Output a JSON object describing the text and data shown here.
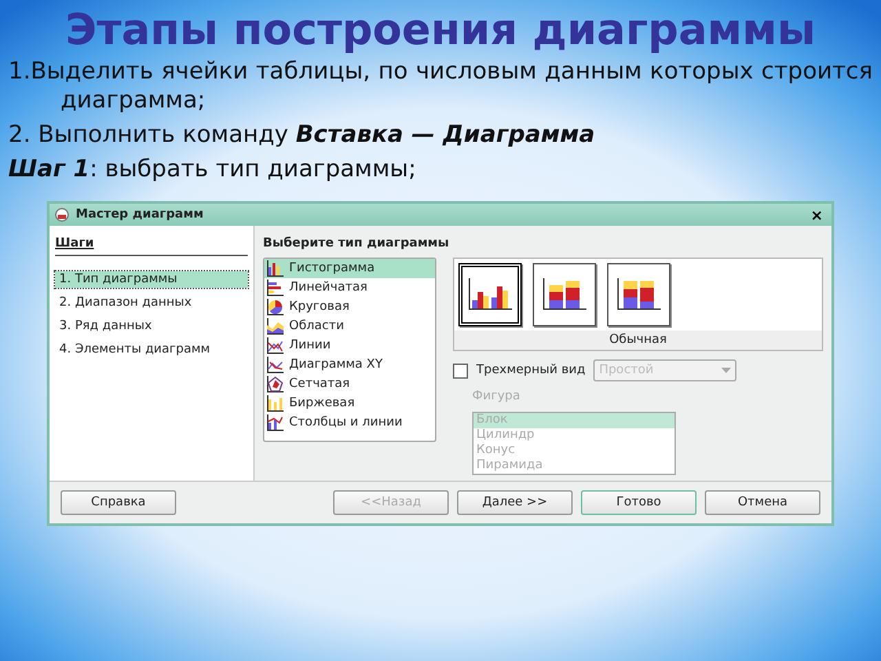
{
  "title": "Этапы построения диаграммы",
  "points": [
    {
      "kind": "numbered",
      "text": "1.Выделить ячейки таблицы, по числовым данным которых строится диаграмма;"
    },
    {
      "kind": "plain",
      "text": "2. Выполнить команду **Вставка — Диаграмма**"
    },
    {
      "kind": "plain",
      "text": "**Шаг 1**: выбрать тип диаграммы;"
    }
  ],
  "dialog": {
    "title": "Мастер диаграмм",
    "close": "×",
    "steps_heading": "Шаги",
    "steps": [
      {
        "label": "1. Тип диаграммы",
        "selected": true
      },
      {
        "label": "2. Диапазон данных",
        "selected": false
      },
      {
        "label": "3. Ряд данных",
        "selected": false
      },
      {
        "label": "4. Элементы диаграмм",
        "selected": false
      }
    ],
    "types_heading": "Выберите тип диаграммы",
    "chart_types": [
      {
        "label": "Гистограмма",
        "selected": true
      },
      {
        "label": "Линейчатая",
        "selected": false
      },
      {
        "label": "Круговая",
        "selected": false
      },
      {
        "label": "Области",
        "selected": false
      },
      {
        "label": "Линии",
        "selected": false
      },
      {
        "label": "Диаграмма XY",
        "selected": false
      },
      {
        "label": "Сетчатая",
        "selected": false
      },
      {
        "label": "Биржевая",
        "selected": false
      },
      {
        "label": "Столбцы и линии",
        "selected": false
      }
    ],
    "variants": [
      {
        "kind": "grouped",
        "selected": true
      },
      {
        "kind": "stacked",
        "selected": false
      },
      {
        "kind": "percent",
        "selected": false
      }
    ],
    "variant_caption": "Обычная",
    "three_d": {
      "label": "Трехмерный вид",
      "checked": false
    },
    "look": {
      "value": "Простой",
      "disabled": true
    },
    "shape_label": "Фигура",
    "shapes": [
      {
        "label": "Блок",
        "selected": true
      },
      {
        "label": "Цилиндр",
        "selected": false
      },
      {
        "label": "Конус",
        "selected": false
      },
      {
        "label": "Пирамида",
        "selected": false
      }
    ],
    "shapes_disabled": true,
    "buttons": [
      {
        "label": "Справка",
        "disabled": false,
        "default": false
      },
      {
        "label": "<<Назад",
        "disabled": true,
        "default": false
      },
      {
        "label": "Далее >>",
        "disabled": false,
        "default": false
      },
      {
        "label": "Готово",
        "disabled": false,
        "default": true
      },
      {
        "label": "Отмена",
        "disabled": false,
        "default": false
      }
    ]
  }
}
